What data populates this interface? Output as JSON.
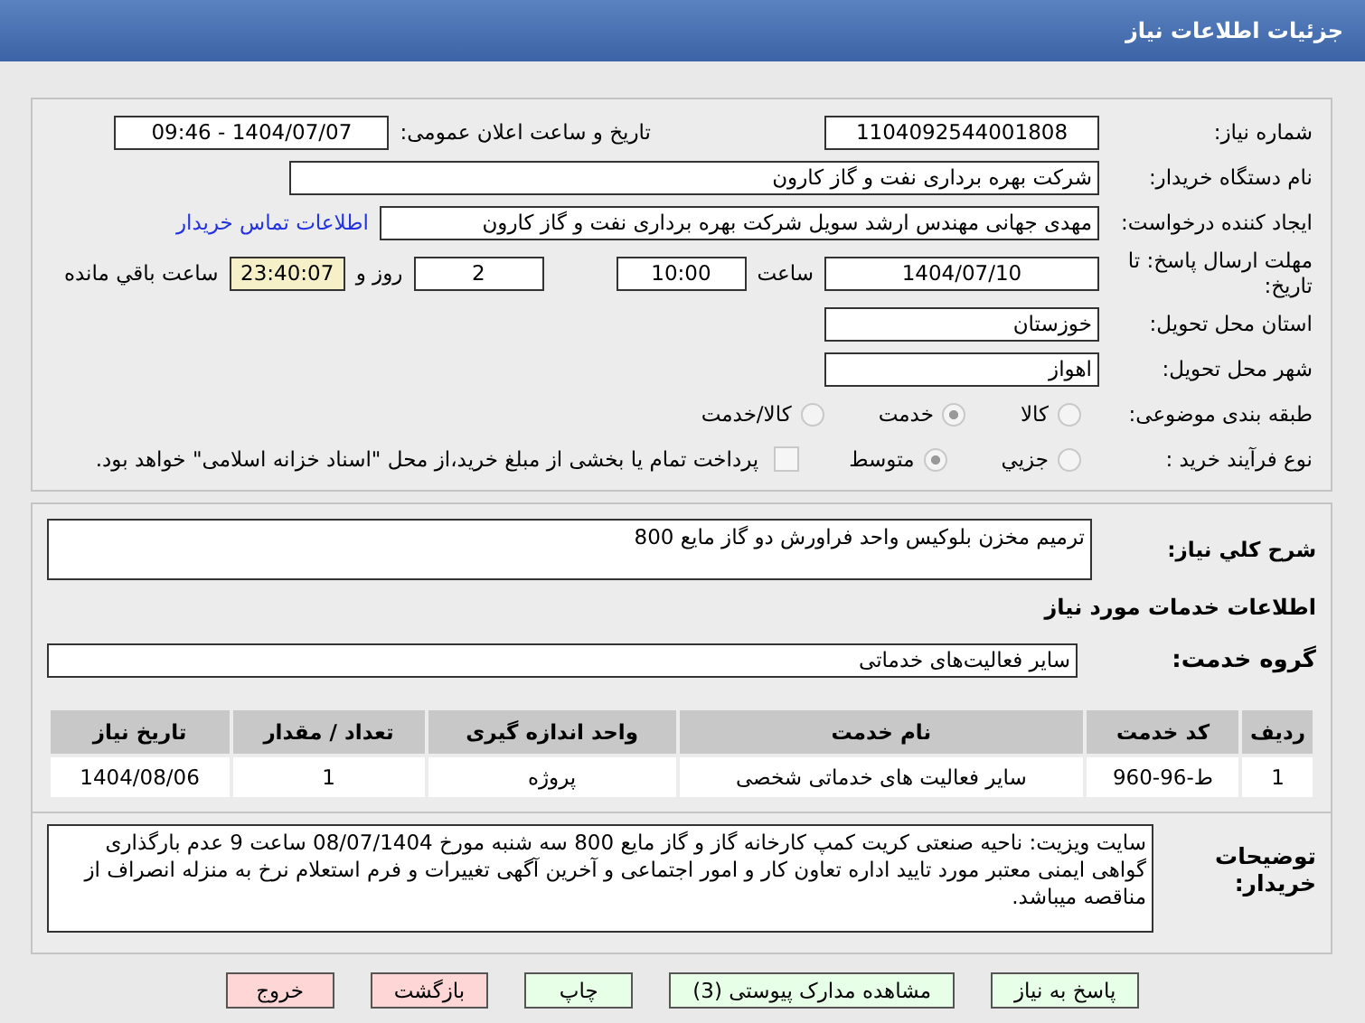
{
  "header": {
    "title": "جزئیات اطلاعات نیاز"
  },
  "details": {
    "need_number": {
      "label": "شماره نیاز:",
      "value": "1104092544001808"
    },
    "announce": {
      "label": "تاریخ و ساعت اعلان عمومی:",
      "value": "1404/07/07 - 09:46"
    },
    "buyer": {
      "label": "نام دستگاه خریدار:",
      "value": "شرکت بهره برداری نفت و گاز کارون"
    },
    "creator": {
      "label": "ایجاد کننده درخواست:",
      "value": "مهدی جهانی مهندس ارشد سویل شرکت بهره برداری نفت و گاز کارون",
      "link": "اطلاعات تماس خریدار"
    },
    "deadline": {
      "label": "مهلت ارسال پاسخ: تا تاریخ:",
      "date": "1404/07/10",
      "time_label": "ساعت",
      "time": "10:00",
      "days": "2",
      "days_label": "روز و",
      "remaining": "23:40:07",
      "remaining_label": "ساعت باقي مانده"
    },
    "province": {
      "label": "استان محل تحویل:",
      "value": "خوزستان"
    },
    "city": {
      "label": "شهر محل تحویل:",
      "value": "اهواز"
    },
    "category": {
      "label": "طبقه بندی موضوعی:",
      "options": [
        {
          "label": "کالا",
          "selected": false
        },
        {
          "label": "خدمت",
          "selected": true
        },
        {
          "label": "کالا/خدمت",
          "selected": false
        }
      ]
    },
    "process": {
      "label": "نوع فرآیند خرید :",
      "options": [
        {
          "label": "جزيي",
          "selected": false
        },
        {
          "label": "متوسط",
          "selected": true
        }
      ],
      "payment": {
        "checked": false,
        "label": "پرداخت تمام یا بخشی از مبلغ خرید،از محل \"اسناد خزانه اسلامی\" خواهد بود."
      }
    }
  },
  "summary": {
    "label": "شرح کلي نیاز:",
    "value": "ترمیم مخزن بلوکیس واحد فراورش دو گاز مایع 800"
  },
  "services_title": "اطلاعات خدمات مورد نیاز",
  "service_group": {
    "label": "گروه خدمت:",
    "value": "سایر فعالیت‌های خدماتی"
  },
  "table": {
    "columns": [
      "ردیف",
      "کد خدمت",
      "نام خدمت",
      "واحد اندازه گیری",
      "تعداد / مقدار",
      "تاریخ نیاز"
    ],
    "rows": [
      [
        "1",
        "ط-96-960",
        "سایر فعالیت های خدماتی شخصی",
        "پروژه",
        "1",
        "1404/08/06"
      ]
    ]
  },
  "notes": {
    "label": "توضیحات خریدار:",
    "value": "سایت ویزیت: ناحیه صنعتی کریت کمپ کارخانه گاز و گاز مایع 800 سه شنبه مورخ 08/07/1404 ساعت 9 عدم بارگذاری گواهی ایمنی معتبر مورد تایید اداره تعاون کار و امور اجتماعی و آخرین آگهی تغییرات و فرم استعلام نرخ به منزله انصراف از مناقصه میباشد."
  },
  "buttons": [
    {
      "label": "پاسخ به نیاز",
      "kind": "normal"
    },
    {
      "label": "مشاهده مدارک پیوستی (3)",
      "kind": "normal"
    },
    {
      "label": "چاپ",
      "kind": "normal"
    },
    {
      "label": "بازگشت",
      "kind": "danger"
    },
    {
      "label": "خروج",
      "kind": "danger"
    }
  ]
}
